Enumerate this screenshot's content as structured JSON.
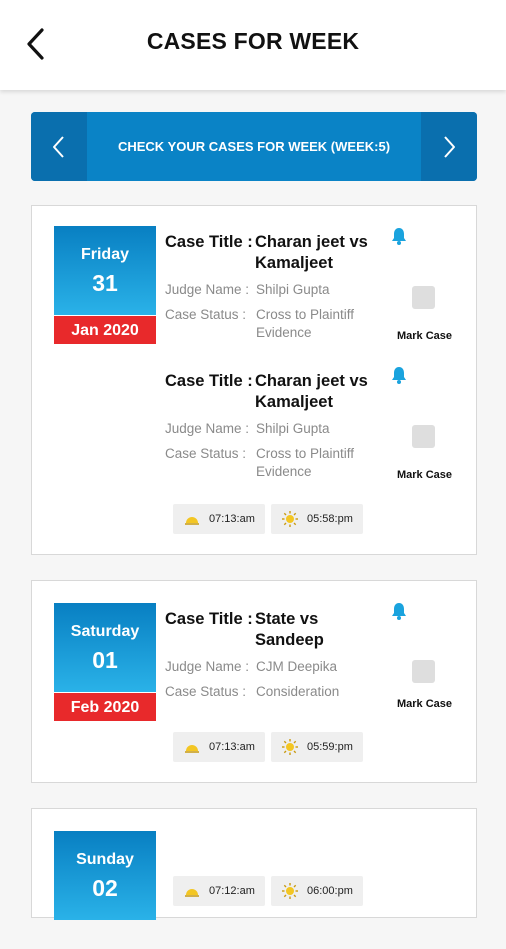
{
  "header": {
    "title": "CASES FOR WEEK"
  },
  "weekbar": {
    "text": "CHECK YOUR CASES FOR WEEK (WEEK:5)"
  },
  "labels": {
    "case_title": "Case Title :",
    "judge_name": "Judge Name :",
    "case_status": "Case Status :",
    "mark_case": "Mark Case"
  },
  "days": [
    {
      "day": "Friday",
      "date": "31",
      "month": "Jan 2020",
      "cases": [
        {
          "title": "Charan jeet vs Kamaljeet",
          "judge": "Shilpi Gupta",
          "status": "Cross to Plaintiff Evidence"
        },
        {
          "title": "Charan jeet vs Kamaljeet",
          "judge": "Shilpi Gupta",
          "status": "Cross to Plaintiff Evidence"
        }
      ],
      "sunrise": "07:13:am",
      "sunset": "05:58:pm"
    },
    {
      "day": "Saturday",
      "date": "01",
      "month": "Feb 2020",
      "cases": [
        {
          "title": "State vs Sandeep",
          "judge": "CJM Deepika",
          "status": "Consideration"
        }
      ],
      "sunrise": "07:13:am",
      "sunset": "05:59:pm"
    },
    {
      "day": "Sunday",
      "date": "02",
      "sunrise": "07:12:am",
      "sunset": "06:00:pm"
    }
  ],
  "colors": {
    "accent": "#0a83c6",
    "month_red": "#e8292b",
    "bell": "#1aa3de"
  },
  "icons": {
    "back": "chevron-left-icon",
    "prev": "chevron-left-icon",
    "next": "chevron-right-icon",
    "bell": "bell-icon",
    "sunrise": "sunrise-icon",
    "sunset": "sun-icon"
  }
}
